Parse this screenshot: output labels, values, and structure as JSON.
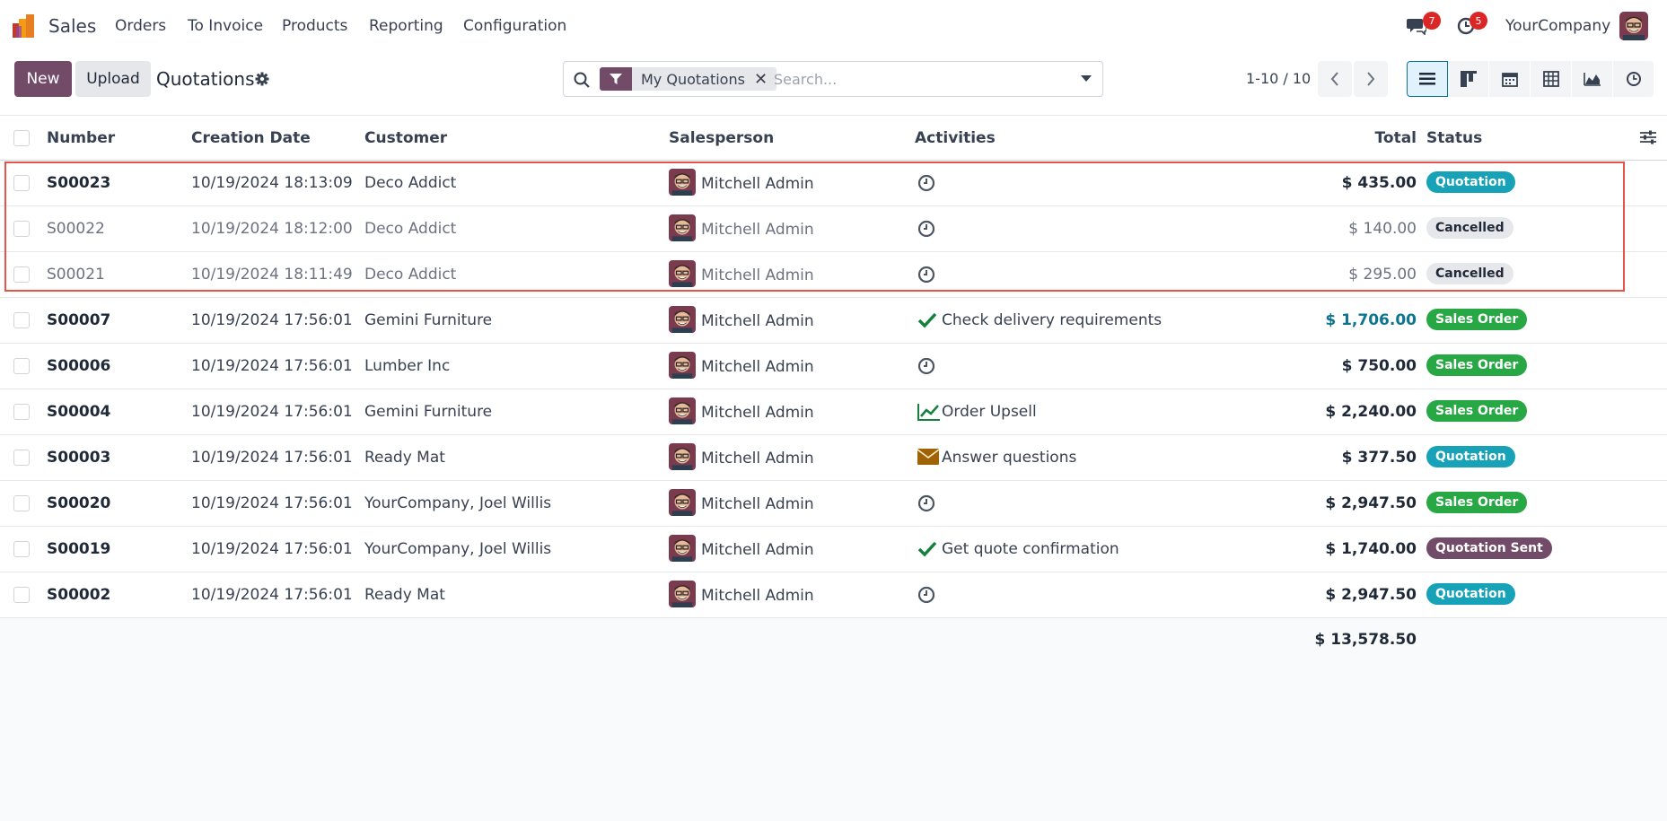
{
  "nav": {
    "app_name": "Sales",
    "menu": [
      "Orders",
      "To Invoice",
      "Products",
      "Reporting",
      "Configuration"
    ],
    "messages_count": "7",
    "activities_count": "5",
    "company": "YourCompany"
  },
  "control": {
    "new_label": "New",
    "upload_label": "Upload",
    "title": "Quotations",
    "facet_label": "My Quotations",
    "search_placeholder": "Search...",
    "pager": "1-10 / 10"
  },
  "table": {
    "headers": {
      "number": "Number",
      "creation_date": "Creation Date",
      "customer": "Customer",
      "salesperson": "Salesperson",
      "activities": "Activities",
      "total": "Total",
      "status": "Status"
    },
    "rows": [
      {
        "number": "S00023",
        "date": "10/19/2024 18:13:09",
        "customer": "Deco Addict",
        "salesperson": "Mitchell Admin",
        "activity_icon": "clock-icon",
        "activity": "",
        "total": "$ 435.00",
        "status": "Quotation",
        "status_kind": "quotation",
        "muted": false
      },
      {
        "number": "S00022",
        "date": "10/19/2024 18:12:00",
        "customer": "Deco Addict",
        "salesperson": "Mitchell Admin",
        "activity_icon": "clock-icon",
        "activity": "",
        "total": "$ 140.00",
        "status": "Cancelled",
        "status_kind": "cancelled",
        "muted": true
      },
      {
        "number": "S00021",
        "date": "10/19/2024 18:11:49",
        "customer": "Deco Addict",
        "salesperson": "Mitchell Admin",
        "activity_icon": "clock-icon",
        "activity": "",
        "total": "$ 295.00",
        "status": "Cancelled",
        "status_kind": "cancelled",
        "muted": true
      },
      {
        "number": "S00007",
        "date": "10/19/2024 17:56:01",
        "customer": "Gemini Furniture",
        "salesperson": "Mitchell Admin",
        "activity_icon": "check-icon",
        "activity": "Check delivery requirements",
        "total": "$ 1,706.00",
        "status": "Sales Order",
        "status_kind": "sales",
        "muted": false,
        "total_accent": true
      },
      {
        "number": "S00006",
        "date": "10/19/2024 17:56:01",
        "customer": "Lumber Inc",
        "salesperson": "Mitchell Admin",
        "activity_icon": "clock-icon",
        "activity": "",
        "total": "$ 750.00",
        "status": "Sales Order",
        "status_kind": "sales",
        "muted": false
      },
      {
        "number": "S00004",
        "date": "10/19/2024 17:56:01",
        "customer": "Gemini Furniture",
        "salesperson": "Mitchell Admin",
        "activity_icon": "chart-line-icon",
        "activity": "Order Upsell",
        "total": "$ 2,240.00",
        "status": "Sales Order",
        "status_kind": "sales",
        "muted": false
      },
      {
        "number": "S00003",
        "date": "10/19/2024 17:56:01",
        "customer": "Ready Mat",
        "salesperson": "Mitchell Admin",
        "activity_icon": "envelope-icon",
        "activity": "Answer questions",
        "total": "$ 377.50",
        "status": "Quotation",
        "status_kind": "quotation",
        "muted": false
      },
      {
        "number": "S00020",
        "date": "10/19/2024 17:56:01",
        "customer": "YourCompany, Joel Willis",
        "salesperson": "Mitchell Admin",
        "activity_icon": "clock-icon",
        "activity": "",
        "total": "$ 2,947.50",
        "status": "Sales Order",
        "status_kind": "sales",
        "muted": false
      },
      {
        "number": "S00019",
        "date": "10/19/2024 17:56:01",
        "customer": "YourCompany, Joel Willis",
        "salesperson": "Mitchell Admin",
        "activity_icon": "check-icon",
        "activity": "Get quote confirmation",
        "total": "$ 1,740.00",
        "status": "Quotation Sent",
        "status_kind": "sent",
        "muted": false
      },
      {
        "number": "S00002",
        "date": "10/19/2024 17:56:01",
        "customer": "Ready Mat",
        "salesperson": "Mitchell Admin",
        "activity_icon": "clock-icon",
        "activity": "",
        "total": "$ 2,947.50",
        "status": "Quotation",
        "status_kind": "quotation",
        "muted": false
      }
    ],
    "grand_total": "$ 13,578.50"
  },
  "colors": {
    "brand": "#714B67",
    "quotation": "#17a2b8",
    "sales": "#28a745",
    "sent": "#714B67",
    "cancelled": "#e5e7eb",
    "accent_total": "#0e7490"
  }
}
